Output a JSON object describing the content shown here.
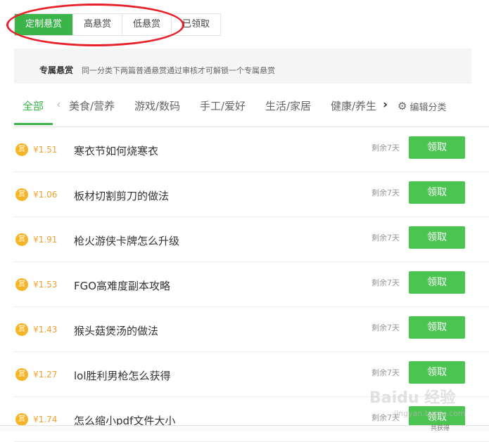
{
  "top_tabs": [
    {
      "label": "定制悬赏",
      "active": true
    },
    {
      "label": "高悬赏",
      "active": false
    },
    {
      "label": "低悬赏",
      "active": false
    },
    {
      "label": "已领取",
      "active": false
    }
  ],
  "notice": {
    "title": "专属悬赏",
    "description": "同一分类下两篇普通悬赏通过审核才可解锁一个专属悬赏"
  },
  "categories": [
    "全部",
    "美食/营养",
    "游戏/数码",
    "手工/爱好",
    "生活/家居",
    "健康/养生"
  ],
  "category_nav": {
    "left_arrow": "‹",
    "right_arrow": "›",
    "edit_label": "编辑分类"
  },
  "list": [
    {
      "badge": "赏",
      "amount": "¥1.51",
      "title": "寒衣节如何烧寒衣",
      "remaining": "剩余7天",
      "button": "领取"
    },
    {
      "badge": "赏",
      "amount": "¥1.06",
      "title": "板材切割剪刀的做法",
      "remaining": "剩余7天",
      "button": "领取"
    },
    {
      "badge": "赏",
      "amount": "¥1.91",
      "title": "枪火游侠卡牌怎么升级",
      "remaining": "剩余7天",
      "button": "领取"
    },
    {
      "badge": "赏",
      "amount": "¥1.53",
      "title": "FGO高难度副本攻略",
      "remaining": "剩余7天",
      "button": "领取"
    },
    {
      "badge": "赏",
      "amount": "¥1.43",
      "title": "猴头菇煲汤的做法",
      "remaining": "剩余7天",
      "button": "领取"
    },
    {
      "badge": "赏",
      "amount": "¥1.27",
      "title": "lol胜利男枪怎么获得",
      "remaining": "剩余7天",
      "button": "领取"
    },
    {
      "badge": "赏",
      "amount": "¥1.74",
      "title": "怎么缩小pdf文件大小",
      "remaining": "剩余7天",
      "button": "领取"
    }
  ],
  "watermark": {
    "text": "Baidu 经验",
    "url": "jingyan.baidu.com"
  },
  "bottom_bar": {
    "item": "共获得"
  },
  "colors": {
    "accent": "#3bb54a",
    "button": "#4cc451",
    "coin": "#f6b527",
    "amount": "#f0a030",
    "annotation": "#e8202a"
  }
}
